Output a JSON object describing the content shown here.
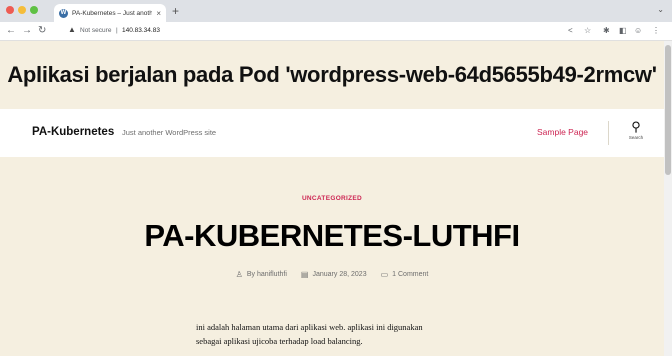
{
  "browser": {
    "tab_title": "PA-Kubernetes – Just anoth",
    "tab_favicon": "W",
    "new_tab": "+",
    "close": "×",
    "address": {
      "security": "Not secure",
      "separator": "|",
      "url": "140.83.34.83"
    },
    "icons": [
      "back-icon",
      "forward-icon",
      "reload-icon",
      "warning-icon",
      "share-icon",
      "star-icon",
      "extensions-icon",
      "sidebar-icon",
      "profile-icon",
      "menu-icon"
    ]
  },
  "banner": {
    "text": "Aplikasi berjalan pada Pod 'wordpress-web-64d5655b49-2rmcw'"
  },
  "header": {
    "site_title": "PA-Kubernetes",
    "site_description": "Just another WordPress site",
    "menu": [
      {
        "label": "Sample Page"
      }
    ],
    "search_label": "Search"
  },
  "post": {
    "category": "UNCATEGORIZED",
    "title": "PA-KUBERNETES-LUTHFI",
    "meta": {
      "author": "By hanifluthfi",
      "date": "January 28, 2023",
      "comments": "1 Comment"
    },
    "body_lines": [
      "ini adalah halaman utama dari aplikasi web. aplikasi ini digunakan",
      "sebagai aplikasi ujicoba terhadap load balancing."
    ]
  },
  "colors": {
    "accent": "#cd2653",
    "background": "#f5efe0"
  }
}
